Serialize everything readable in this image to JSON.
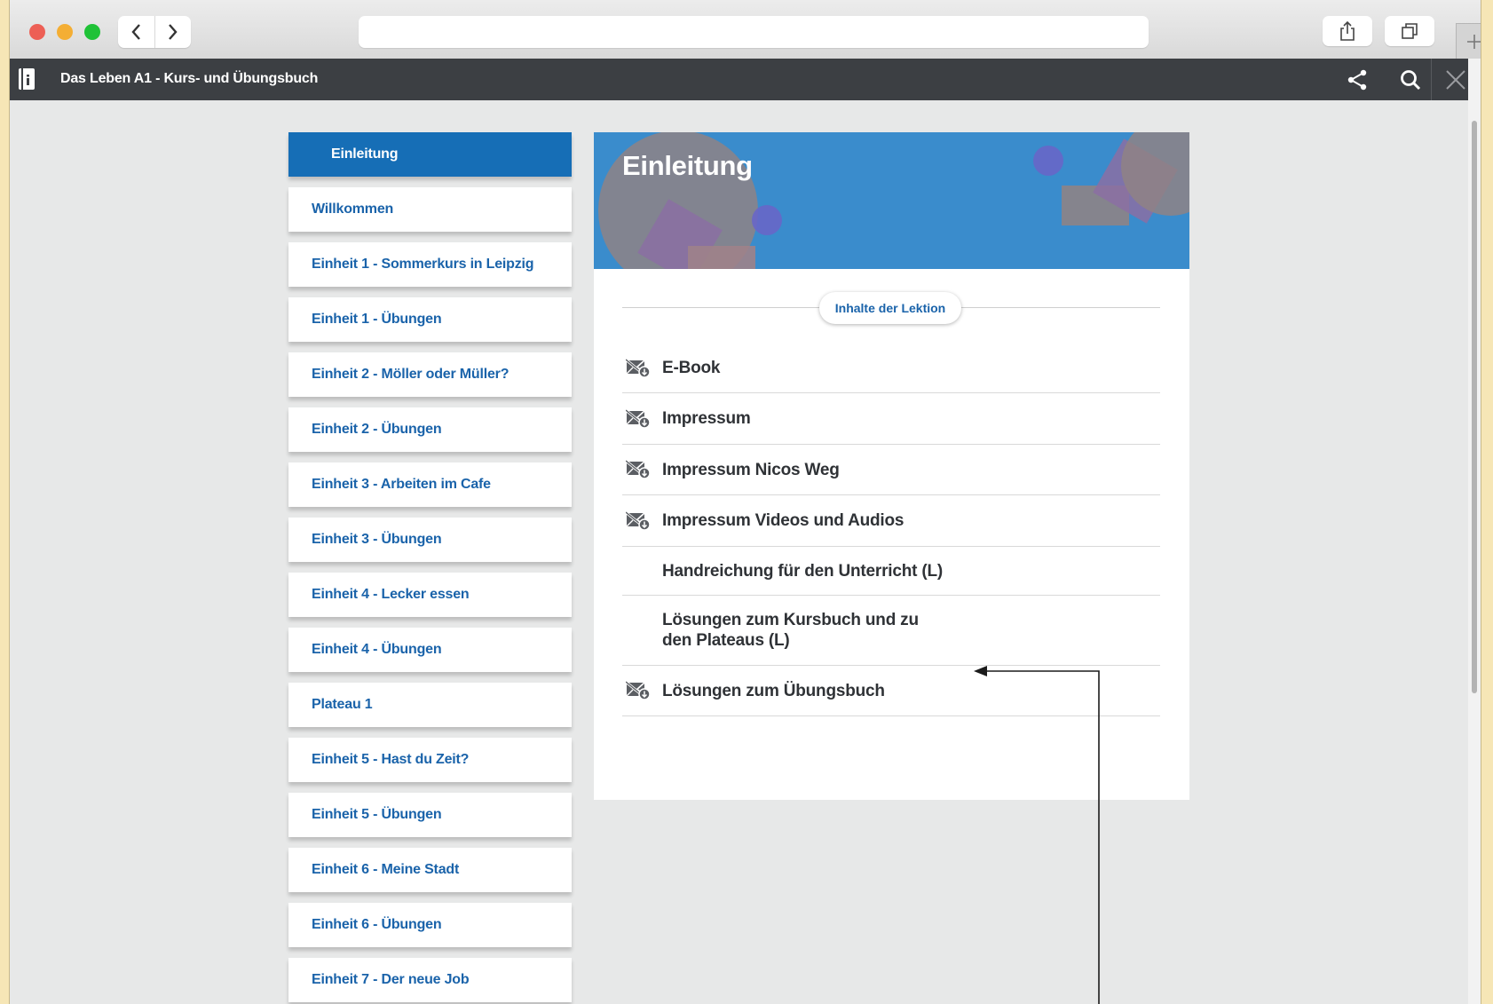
{
  "browser": {
    "back_icon": "chevron-left-icon",
    "forward_icon": "chevron-right-icon",
    "share_icon": "share-box-icon",
    "tabs_icon": "tabs-icon",
    "new_tab_icon": "plus-icon",
    "url": ""
  },
  "appbar": {
    "title": "Das Leben A1 - Kurs- und Übungsbuch",
    "book_icon": "book-icon",
    "share_icon": "share-icon",
    "search_icon": "search-icon",
    "close_icon": "close-icon"
  },
  "sidebar": {
    "items": [
      {
        "label": "Einleitung",
        "active": true
      },
      {
        "label": "Willkommen"
      },
      {
        "label": "Einheit 1 - Sommerkurs in Leipzig"
      },
      {
        "label": "Einheit 1 - Übungen"
      },
      {
        "label": "Einheit 2 - Möller oder Müller?"
      },
      {
        "label": "Einheit 2 - Übungen"
      },
      {
        "label": "Einheit 3 - Arbeiten im Cafe"
      },
      {
        "label": "Einheit 3 - Übungen"
      },
      {
        "label": "Einheit 4 - Lecker essen"
      },
      {
        "label": "Einheit 4 - Übungen"
      },
      {
        "label": "Plateau 1"
      },
      {
        "label": "Einheit 5 - Hast du Zeit?"
      },
      {
        "label": "Einheit 5 - Übungen"
      },
      {
        "label": "Einheit 6 - Meine Stadt"
      },
      {
        "label": "Einheit 6 - Übungen"
      },
      {
        "label": "Einheit 7 - Der neue Job"
      }
    ]
  },
  "main": {
    "title": "Einleitung",
    "section_label": "Inhalte der Lektion",
    "contents": [
      {
        "label": "E-Book",
        "icon": "offline-download-icon"
      },
      {
        "label": "Impressum",
        "icon": "offline-download-icon"
      },
      {
        "label": "Impressum Nicos Weg",
        "icon": "offline-download-icon"
      },
      {
        "label": "Impressum Videos und Audios",
        "icon": "offline-download-icon"
      },
      {
        "label": "Handreichung für den Unterricht (L)",
        "icon": ""
      },
      {
        "label": "Lösungen zum Kursbuch und zu den Plateaus (L)",
        "icon": ""
      },
      {
        "label": "Lösungen zum Übungsbuch",
        "icon": "offline-download-icon"
      }
    ]
  },
  "colors": {
    "accent": "#166eb6",
    "link": "#1a63aa",
    "banner": "#3a8ccc",
    "appbar": "#3c3f43"
  }
}
